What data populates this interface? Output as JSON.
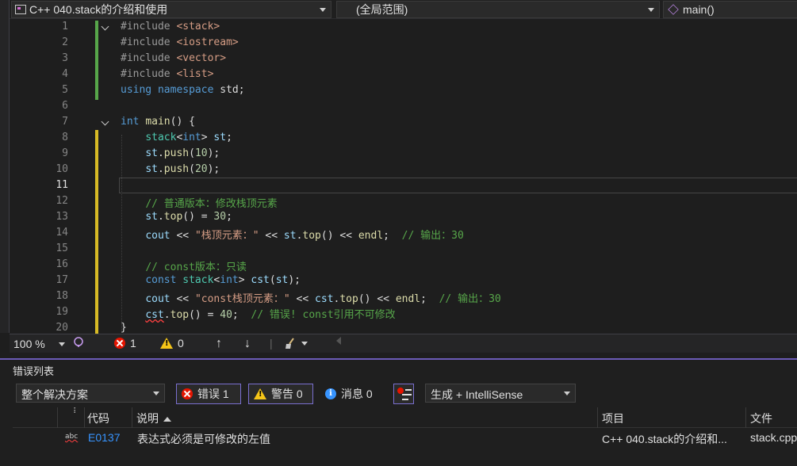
{
  "navbar": {
    "project": "C++ 040.stack的介绍和使用",
    "scope": "(全局范围)",
    "member": "main()"
  },
  "editor": {
    "current_line": 11,
    "lines": [
      {
        "n": "1",
        "html": "<span class='inc'>#include</span> <span class='str'>&lt;stack&gt;</span>"
      },
      {
        "n": "2",
        "html": "<span class='inc'>#include</span> <span class='str'>&lt;iostream&gt;</span>"
      },
      {
        "n": "3",
        "html": "<span class='inc'>#include</span> <span class='str'>&lt;vector&gt;</span>"
      },
      {
        "n": "4",
        "html": "<span class='inc'>#include</span> <span class='str'>&lt;list&gt;</span>"
      },
      {
        "n": "5",
        "html": "<span class='kw'>using</span> <span class='kw'>namespace</span> std;"
      },
      {
        "n": "6",
        "html": ""
      },
      {
        "n": "7",
        "html": "<span class='kw'>int</span> <span class='fn'>main</span>() {"
      },
      {
        "n": "8",
        "html": "    <span class='typ'>stack</span>&lt;<span class='kw'>int</span>&gt; <span class='var'>st</span>;"
      },
      {
        "n": "9",
        "html": "    <span class='var'>st</span>.<span class='fn'>push</span>(<span class='num'>10</span>);"
      },
      {
        "n": "10",
        "html": "    <span class='var'>st</span>.<span class='fn'>push</span>(<span class='num'>20</span>);"
      },
      {
        "n": "11",
        "html": ""
      },
      {
        "n": "12",
        "html": "    <span class='cmt'>// 普通版本：修改栈顶元素</span>"
      },
      {
        "n": "13",
        "html": "    <span class='var'>st</span>.<span class='fn'>top</span>() = <span class='num'>30</span>;"
      },
      {
        "n": "14",
        "html": "    <span class='var'>cout</span> &lt;&lt; <span class='str'>\"栈顶元素：\"</span> &lt;&lt; <span class='var'>st</span>.<span class='fn'>top</span>() &lt;&lt; <span class='fn'>endl</span>;  <span class='cmt'>// 输出：30</span>"
      },
      {
        "n": "15",
        "html": ""
      },
      {
        "n": "16",
        "html": "    <span class='cmt'>// const版本：只读</span>"
      },
      {
        "n": "17",
        "html": "    <span class='kw'>const</span> <span class='typ'>stack</span>&lt;<span class='kw'>int</span>&gt; <span class='var'>cst</span>(<span class='var'>st</span>);"
      },
      {
        "n": "18",
        "html": "    <span class='var'>cout</span> &lt;&lt; <span class='str'>\"const栈顶元素：\"</span> &lt;&lt; <span class='var'>cst</span>.<span class='fn'>top</span>() &lt;&lt; <span class='fn'>endl</span>;  <span class='cmt'>// 输出：30</span>"
      },
      {
        "n": "19",
        "html": "    <span class='var squiggle'>cst</span>.<span class='fn'>top</span>() = <span class='num'>40</span>;  <span class='cmt'>// 错误! const引用不可修改</span>"
      },
      {
        "n": "20",
        "html": "}"
      }
    ]
  },
  "status": {
    "zoom": "100 %",
    "errors": "1",
    "warnings": "0"
  },
  "errorlist": {
    "title": "错误列表",
    "scope": "整个解决方案",
    "errors_btn": "错误 1",
    "warnings_btn": "警告 0",
    "messages_btn": "消息 0",
    "build_filter": "生成 + IntelliSense",
    "headers": {
      "code": "代码",
      "desc": "说明",
      "project": "项目",
      "file": "文件"
    },
    "row": {
      "code": "E0137",
      "desc": "表达式必须是可修改的左值",
      "project": "C++ 040.stack的介绍和...",
      "file": "stack.cpp"
    }
  }
}
